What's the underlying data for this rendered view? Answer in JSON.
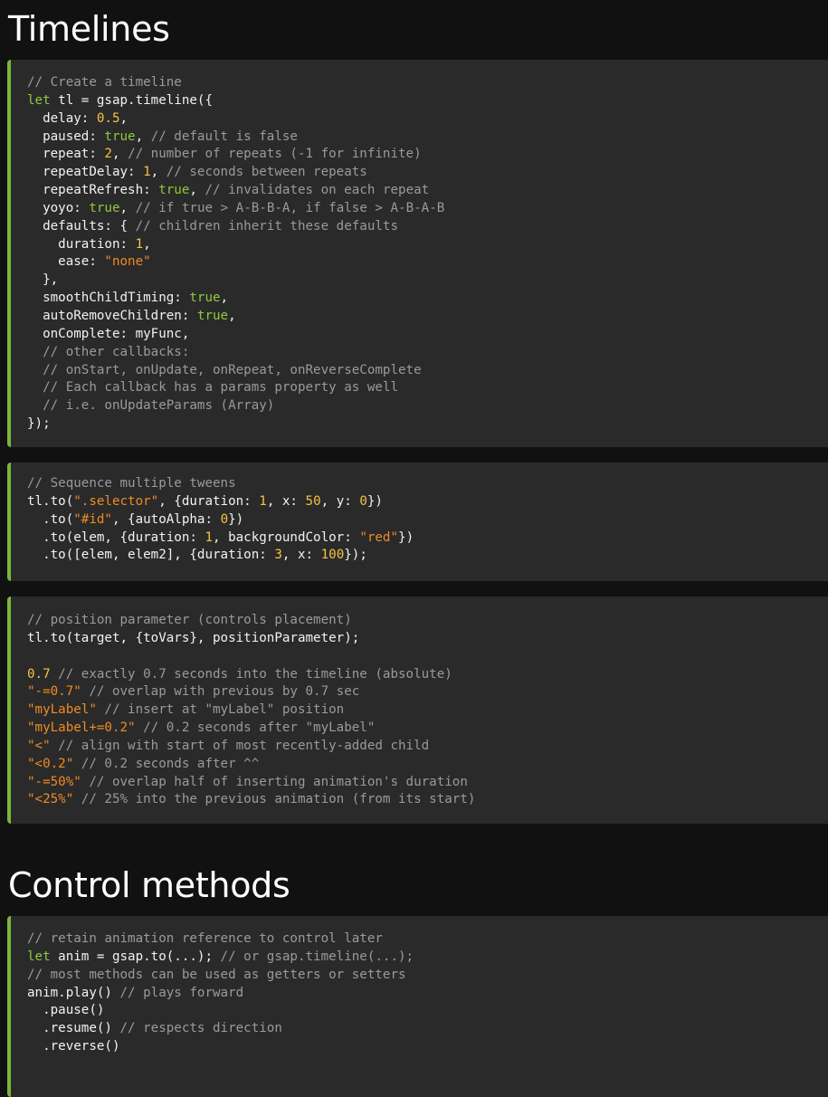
{
  "sections": {
    "timelines_title": "Timelines",
    "control_title": "Control methods"
  },
  "blocks": [
    {
      "lines": [
        [
          [
            "cm",
            "// Create a timeline"
          ]
        ],
        [
          [
            "kw",
            "let"
          ],
          [
            "tx",
            " tl = gsap.timeline({"
          ]
        ],
        [
          [
            "tx",
            "  delay: "
          ],
          [
            "num",
            "0.5"
          ],
          [
            "tx",
            ","
          ]
        ],
        [
          [
            "tx",
            "  paused: "
          ],
          [
            "kw",
            "true"
          ],
          [
            "tx",
            ", "
          ],
          [
            "cm",
            "// default is false"
          ]
        ],
        [
          [
            "tx",
            "  repeat: "
          ],
          [
            "num",
            "2"
          ],
          [
            "tx",
            ", "
          ],
          [
            "cm",
            "// number of repeats (-1 for infinite)"
          ]
        ],
        [
          [
            "tx",
            "  repeatDelay: "
          ],
          [
            "num",
            "1"
          ],
          [
            "tx",
            ", "
          ],
          [
            "cm",
            "// seconds between repeats"
          ]
        ],
        [
          [
            "tx",
            "  repeatRefresh: "
          ],
          [
            "kw",
            "true"
          ],
          [
            "tx",
            ", "
          ],
          [
            "cm",
            "// invalidates on each repeat"
          ]
        ],
        [
          [
            "tx",
            "  yoyo: "
          ],
          [
            "kw",
            "true"
          ],
          [
            "tx",
            ", "
          ],
          [
            "cm",
            "// if true > A-B-B-A, if false > A-B-A-B"
          ]
        ],
        [
          [
            "tx",
            "  defaults: { "
          ],
          [
            "cm",
            "// children inherit these defaults"
          ]
        ],
        [
          [
            "tx",
            "    duration: "
          ],
          [
            "num",
            "1"
          ],
          [
            "tx",
            ","
          ]
        ],
        [
          [
            "tx",
            "    ease: "
          ],
          [
            "str",
            "\"none\""
          ]
        ],
        [
          [
            "tx",
            "  },"
          ]
        ],
        [
          [
            "tx",
            "  smoothChildTiming: "
          ],
          [
            "kw",
            "true"
          ],
          [
            "tx",
            ","
          ]
        ],
        [
          [
            "tx",
            "  autoRemoveChildren: "
          ],
          [
            "kw",
            "true"
          ],
          [
            "tx",
            ","
          ]
        ],
        [
          [
            "tx",
            "  onComplete: myFunc,"
          ]
        ],
        [
          [
            "cm",
            "  // other callbacks:"
          ]
        ],
        [
          [
            "cm",
            "  // onStart, onUpdate, onRepeat, onReverseComplete"
          ]
        ],
        [
          [
            "cm",
            "  // Each callback has a params property as well"
          ]
        ],
        [
          [
            "cm",
            "  // i.e. onUpdateParams (Array)"
          ]
        ],
        [
          [
            "tx",
            "});"
          ]
        ]
      ]
    },
    {
      "lines": [
        [
          [
            "cm",
            "// Sequence multiple tweens"
          ]
        ],
        [
          [
            "tx",
            "tl.to("
          ],
          [
            "str",
            "\".selector\""
          ],
          [
            "tx",
            ", {duration: "
          ],
          [
            "num",
            "1"
          ],
          [
            "tx",
            ", x: "
          ],
          [
            "num",
            "50"
          ],
          [
            "tx",
            ", y: "
          ],
          [
            "num",
            "0"
          ],
          [
            "tx",
            "})"
          ]
        ],
        [
          [
            "tx",
            "  .to("
          ],
          [
            "str",
            "\"#id\""
          ],
          [
            "tx",
            ", {autoAlpha: "
          ],
          [
            "num",
            "0"
          ],
          [
            "tx",
            "})"
          ]
        ],
        [
          [
            "tx",
            "  .to(elem, {duration: "
          ],
          [
            "num",
            "1"
          ],
          [
            "tx",
            ", backgroundColor: "
          ],
          [
            "str",
            "\"red\""
          ],
          [
            "tx",
            "})"
          ]
        ],
        [
          [
            "tx",
            "  .to([elem, elem2], {duration: "
          ],
          [
            "num",
            "3"
          ],
          [
            "tx",
            ", x: "
          ],
          [
            "num",
            "100"
          ],
          [
            "tx",
            "});"
          ]
        ]
      ]
    },
    {
      "lines": [
        [
          [
            "cm",
            "// position parameter (controls placement)"
          ]
        ],
        [
          [
            "tx",
            "tl.to(target, {toVars}, positionParameter);"
          ]
        ],
        [
          [
            "tx",
            ""
          ]
        ],
        [
          [
            "num",
            "0.7"
          ],
          [
            "tx",
            " "
          ],
          [
            "cm",
            "// exactly 0.7 seconds into the timeline (absolute)"
          ]
        ],
        [
          [
            "str",
            "\"-=0.7\""
          ],
          [
            "tx",
            " "
          ],
          [
            "cm",
            "// overlap with previous by 0.7 sec"
          ]
        ],
        [
          [
            "str",
            "\"myLabel\""
          ],
          [
            "tx",
            " "
          ],
          [
            "cm",
            "// insert at \"myLabel\" position"
          ]
        ],
        [
          [
            "str",
            "\"myLabel+=0.2\""
          ],
          [
            "tx",
            " "
          ],
          [
            "cm",
            "// 0.2 seconds after \"myLabel\""
          ]
        ],
        [
          [
            "str",
            "\"<\""
          ],
          [
            "tx",
            " "
          ],
          [
            "cm",
            "// align with start of most recently-added child"
          ]
        ],
        [
          [
            "str",
            "\"<0.2\""
          ],
          [
            "tx",
            " "
          ],
          [
            "cm",
            "// 0.2 seconds after ^^"
          ]
        ],
        [
          [
            "str",
            "\"-=50%\""
          ],
          [
            "tx",
            " "
          ],
          [
            "cm",
            "// overlap half of inserting animation's duration"
          ]
        ],
        [
          [
            "str",
            "\"<25%\""
          ],
          [
            "tx",
            " "
          ],
          [
            "cm",
            "// 25% into the previous animation (from its start)"
          ]
        ]
      ]
    },
    {
      "lines": [
        [
          [
            "cm",
            "// retain animation reference to control later"
          ]
        ],
        [
          [
            "kw",
            "let"
          ],
          [
            "tx",
            " anim = gsap.to(...); "
          ],
          [
            "cm",
            "// or gsap.timeline(...);"
          ]
        ],
        [
          [
            "cm",
            "// most methods can be used as getters or setters"
          ]
        ],
        [
          [
            "tx",
            "anim.play() "
          ],
          [
            "cm",
            "// plays forward"
          ]
        ],
        [
          [
            "tx",
            "  .pause()"
          ]
        ],
        [
          [
            "tx",
            "  .resume() "
          ],
          [
            "cm",
            "// respects direction"
          ]
        ],
        [
          [
            "tx",
            "  .reverse()"
          ]
        ]
      ]
    }
  ],
  "colors": {
    "accent_border": "#7bb53a",
    "keyword": "#8ecb3d",
    "number": "#f6c344",
    "string": "#f08a24",
    "comment": "#9a9a9a"
  }
}
